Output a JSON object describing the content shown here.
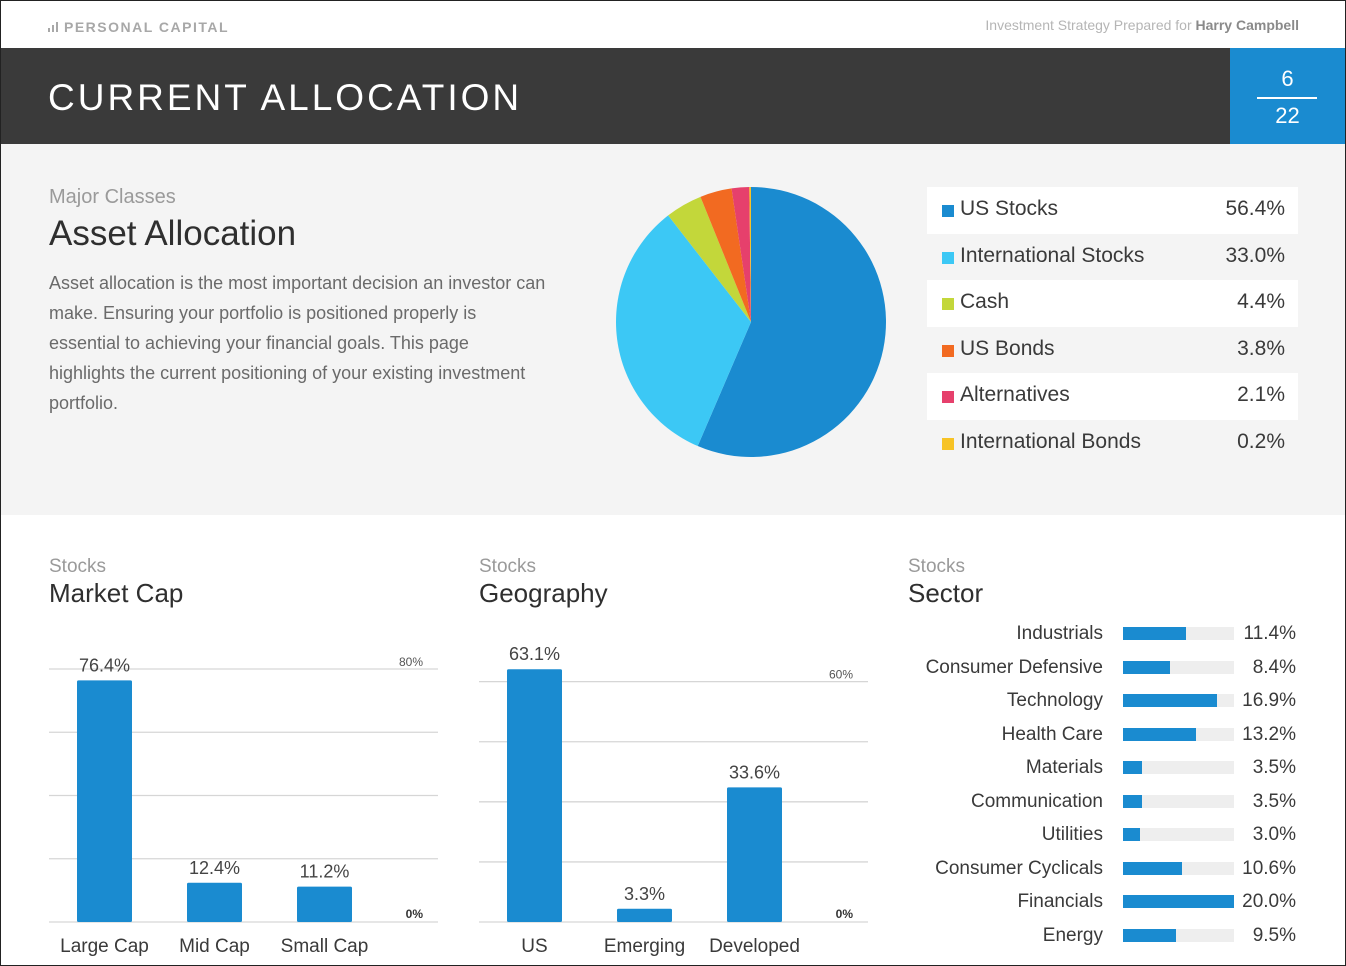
{
  "header": {
    "logo_text": "PERSONAL CAPITAL",
    "prepared_prefix": "Investment Strategy Prepared for",
    "client_name": "Harry Campbell",
    "title": "CURRENT ALLOCATION",
    "page_current": "6",
    "page_total": "22"
  },
  "colors": {
    "accent": "#1a8bd0",
    "banner": "#3a3a3a"
  },
  "asset_allocation": {
    "subtitle": "Major Classes",
    "title": "Asset Allocation",
    "description": "Asset allocation is the most important decision an investor can make. Ensuring your portfolio is positioned properly is essential to achieving your financial goals. This page highlights the current positioning of your existing investment portfolio."
  },
  "market_cap": {
    "subtitle": "Stocks",
    "title": "Market Cap"
  },
  "geography": {
    "subtitle": "Stocks",
    "title": "Geography"
  },
  "sector": {
    "subtitle": "Stocks",
    "title": "Sector"
  },
  "chart_data": [
    {
      "type": "pie",
      "title": "Asset Allocation",
      "categories": [
        "US Stocks",
        "International Stocks",
        "Cash",
        "US Bonds",
        "Alternatives",
        "International Bonds"
      ],
      "values": [
        56.4,
        33.0,
        4.4,
        3.8,
        2.1,
        0.2
      ],
      "labels": [
        "56.4%",
        "33.0%",
        "4.4%",
        "3.8%",
        "2.1%",
        "0.2%"
      ],
      "colors": [
        "#1a8bd0",
        "#3cc8f5",
        "#c3d73a",
        "#f26a21",
        "#e6406c",
        "#f7c325"
      ]
    },
    {
      "type": "bar",
      "title": "Market Cap",
      "categories": [
        "Large Cap",
        "Mid Cap",
        "Small Cap"
      ],
      "values": [
        76.4,
        12.4,
        11.2
      ],
      "labels": [
        "76.4%",
        "12.4%",
        "11.2%"
      ],
      "ylim": [
        0,
        80
      ],
      "ytick_labels": [
        "0%",
        "80%"
      ],
      "grid": true
    },
    {
      "type": "bar",
      "title": "Geography",
      "categories": [
        "US",
        "Emerging",
        "Developed"
      ],
      "values": [
        63.1,
        3.3,
        33.6
      ],
      "labels": [
        "63.1%",
        "3.3%",
        "33.6%"
      ],
      "ylim": [
        0,
        60
      ],
      "ytick_labels": [
        "0%",
        "60%"
      ],
      "grid": true
    },
    {
      "type": "bar",
      "orientation": "horizontal",
      "title": "Sector",
      "categories": [
        "Industrials",
        "Consumer Defensive",
        "Technology",
        "Health Care",
        "Materials",
        "Communication",
        "Utilities",
        "Consumer Cyclicals",
        "Financials",
        "Energy"
      ],
      "values": [
        11.4,
        8.4,
        16.9,
        13.2,
        3.5,
        3.5,
        3.0,
        10.6,
        20.0,
        9.5
      ],
      "labels": [
        "11.4%",
        "8.4%",
        "16.9%",
        "13.2%",
        "3.5%",
        "3.5%",
        "3.0%",
        "10.6%",
        "20.0%",
        "9.5%"
      ],
      "xlim": [
        0,
        20
      ]
    }
  ]
}
